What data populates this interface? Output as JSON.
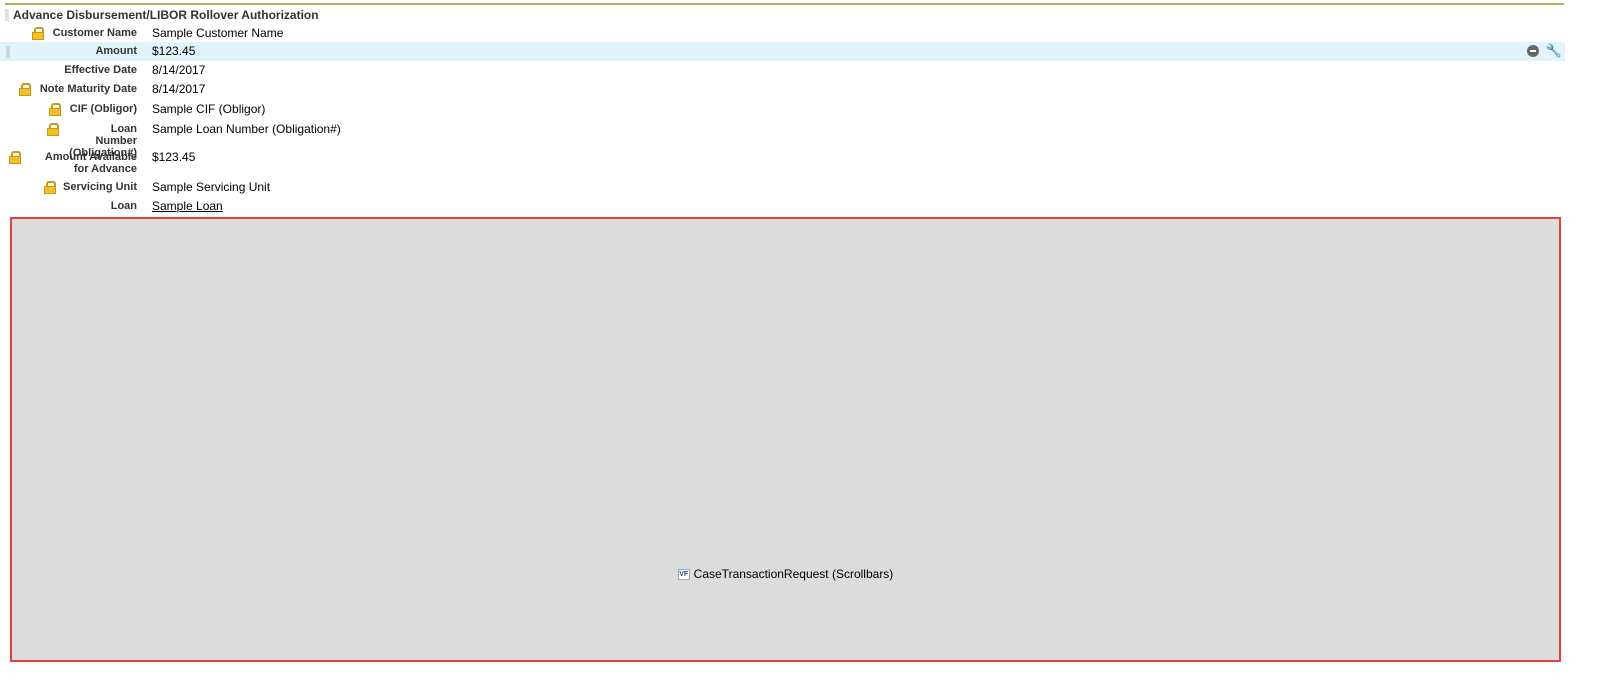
{
  "section_title": "Advance Disbursement/LIBOR Rollover Authorization",
  "fields": [
    {
      "label": "Customer Name",
      "value": "Sample Customer Name",
      "locked": true
    },
    {
      "label": "Amount",
      "value": "$123.45",
      "locked": false
    },
    {
      "label": "Effective Date",
      "value": "8/14/2017",
      "locked": false
    },
    {
      "label": "Note Maturity Date",
      "value": "8/14/2017",
      "locked": true
    },
    {
      "label": "CIF (Obligor)",
      "value": "Sample CIF (Obligor)",
      "locked": true
    },
    {
      "label": "Loan Number (Obligation#)",
      "value": "Sample Loan Number (Obligation#)",
      "locked": true
    },
    {
      "label": "Amount Available for Advance",
      "value": "$123.45",
      "locked": true
    },
    {
      "label": "Servicing Unit",
      "value": "Sample Servicing Unit",
      "locked": true
    },
    {
      "label": "Loan",
      "value": "Sample Loan",
      "locked": false,
      "link": true
    }
  ],
  "frame": {
    "badge": "VF",
    "label": "CaseTransactionRequest (Scrollbars)"
  },
  "colors": {
    "highlight": "#e1f4fb",
    "frame_border": "#e0413e",
    "frame_bg": "#dcdcdc",
    "top_rule": "#b5b060"
  }
}
